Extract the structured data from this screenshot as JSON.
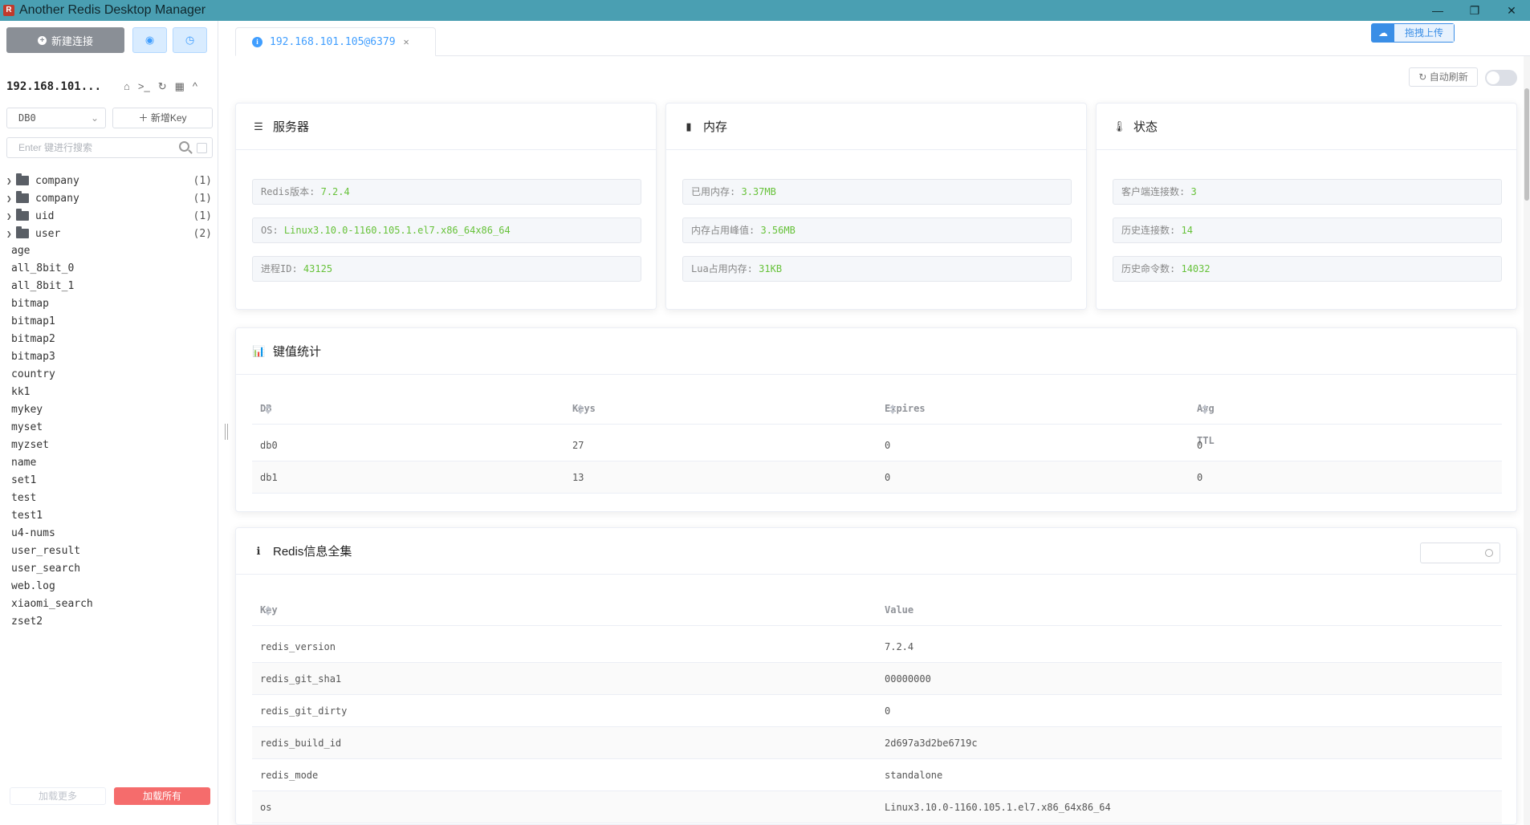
{
  "window": {
    "title": "Another Redis Desktop Manager",
    "controls": [
      "—",
      "❐",
      "✕"
    ]
  },
  "sidebar": {
    "new_connection": "新建连接",
    "connection_name": "192.168.101...",
    "db_select": "DB0",
    "add_key": "新增Key",
    "search_placeholder": "Enter 键进行搜索",
    "folders": [
      {
        "name": "company",
        "count": "(1)"
      },
      {
        "name": "company",
        "count": "(1)"
      },
      {
        "name": "uid",
        "count": "(1)"
      },
      {
        "name": "user",
        "count": "(2)"
      }
    ],
    "keys": [
      "age",
      "all_8bit_0",
      "all_8bit_1",
      "bitmap",
      "bitmap1",
      "bitmap2",
      "bitmap3",
      "country",
      "kk1",
      "mykey",
      "myset",
      "myzset",
      "name",
      "set1",
      "test",
      "test1",
      "u4-nums",
      "user_result",
      "user_search",
      "web.log",
      "xiaomi_search",
      "zset2"
    ],
    "load_more": "加载更多",
    "load_all": "加载所有"
  },
  "tab": {
    "label": "192.168.101.105@6379"
  },
  "upload": {
    "label": "拖拽上传"
  },
  "auto_refresh": {
    "label": "自动刷新",
    "enabled": false
  },
  "server_card": {
    "title": "服务器",
    "items": [
      {
        "label": "Redis版本:",
        "value": "7.2.4"
      },
      {
        "label": "OS:",
        "value": "Linux3.10.0-1160.105.1.el7.x86_64x86_64"
      },
      {
        "label": "进程ID:",
        "value": "43125"
      }
    ]
  },
  "memory_card": {
    "title": "内存",
    "items": [
      {
        "label": "已用内存:",
        "value": "3.37MB"
      },
      {
        "label": "内存占用峰值:",
        "value": "3.56MB"
      },
      {
        "label": "Lua占用内存:",
        "value": "31KB"
      }
    ]
  },
  "status_card": {
    "title": "状态",
    "items": [
      {
        "label": "客户端连接数:",
        "value": "3"
      },
      {
        "label": "历史连接数:",
        "value": "14"
      },
      {
        "label": "历史命令数:",
        "value": "14032"
      }
    ]
  },
  "key_stats": {
    "title": "键值统计",
    "columns": [
      "DB",
      "Keys",
      "Expires",
      "Avg TTL"
    ],
    "rows": [
      [
        "db0",
        "27",
        "0",
        "0"
      ],
      [
        "db1",
        "13",
        "0",
        "0"
      ]
    ]
  },
  "redis_info": {
    "title": "Redis信息全集",
    "columns": [
      "Key",
      "Value"
    ],
    "rows": [
      [
        "redis_version",
        "7.2.4"
      ],
      [
        "redis_git_sha1",
        "00000000"
      ],
      [
        "redis_git_dirty",
        "0"
      ],
      [
        "redis_build_id",
        "2d697a3d2be6719c"
      ],
      [
        "redis_mode",
        "standalone"
      ],
      [
        "os",
        "Linux3.10.0-1160.105.1.el7.x86_64x86_64"
      ]
    ]
  },
  "colors": {
    "accent": "#409eff",
    "value_green": "#67c23a",
    "danger": "#f56c6c",
    "titlebar": "#4a9fb2"
  }
}
